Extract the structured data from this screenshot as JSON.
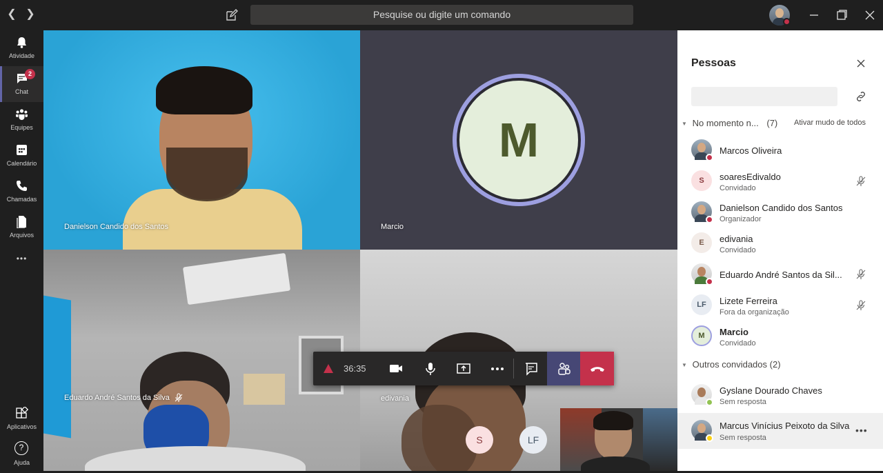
{
  "titlebar": {
    "search_placeholder": "Pesquise ou digite um comando"
  },
  "rail": {
    "items": [
      {
        "label": "Atividade",
        "icon": "bell-icon"
      },
      {
        "label": "Chat",
        "icon": "chat-icon",
        "badge": "2"
      },
      {
        "label": "Equipes",
        "icon": "teams-icon"
      },
      {
        "label": "Calendário",
        "icon": "calendar-icon"
      },
      {
        "label": "Chamadas",
        "icon": "phone-icon"
      },
      {
        "label": "Arquivos",
        "icon": "files-icon"
      }
    ],
    "more": "•••",
    "apps_label": "Aplicativos",
    "help_label": "Ajuda",
    "help_glyph": "?"
  },
  "video": {
    "tiles": [
      {
        "name": "Danielson Candido dos Santos"
      },
      {
        "name": "Marcio",
        "initial": "M"
      },
      {
        "name": "Eduardo André Santos da Silva"
      },
      {
        "name": "edivania"
      }
    ],
    "small_avatars": [
      "S",
      "LF"
    ]
  },
  "controls": {
    "timer": "36:35"
  },
  "people_panel": {
    "title": "Pessoas",
    "current_section": "No momento n...",
    "current_count": "(7)",
    "mute_all": "Ativar mudo de todos",
    "participants": [
      {
        "name": "Marcos Oliveira",
        "sub": ""
      },
      {
        "name": "soaresEdivaldo",
        "sub": "Convidado",
        "initials": "S"
      },
      {
        "name": "Danielson Candido dos Santos",
        "sub": "Organizador"
      },
      {
        "name": "edivania",
        "sub": "Convidado",
        "initials": "E"
      },
      {
        "name": "Eduardo André Santos da Sil...",
        "sub": ""
      },
      {
        "name": "Lizete Ferreira",
        "sub": "Fora da organização",
        "initials": "LF"
      },
      {
        "name": "Marcio",
        "sub": "Convidado",
        "initials": "M"
      }
    ],
    "others_section": "Outros convidados (2)",
    "others": [
      {
        "name": "Gyslane Dourado Chaves",
        "sub": "Sem resposta"
      },
      {
        "name": "Marcus Vinícius Peixoto da Silva",
        "sub": "Sem resposta"
      }
    ]
  },
  "colors": {
    "accent": "#6264a7",
    "busy": "#c4314b",
    "available": "#92c353",
    "away": "#fcd116"
  }
}
